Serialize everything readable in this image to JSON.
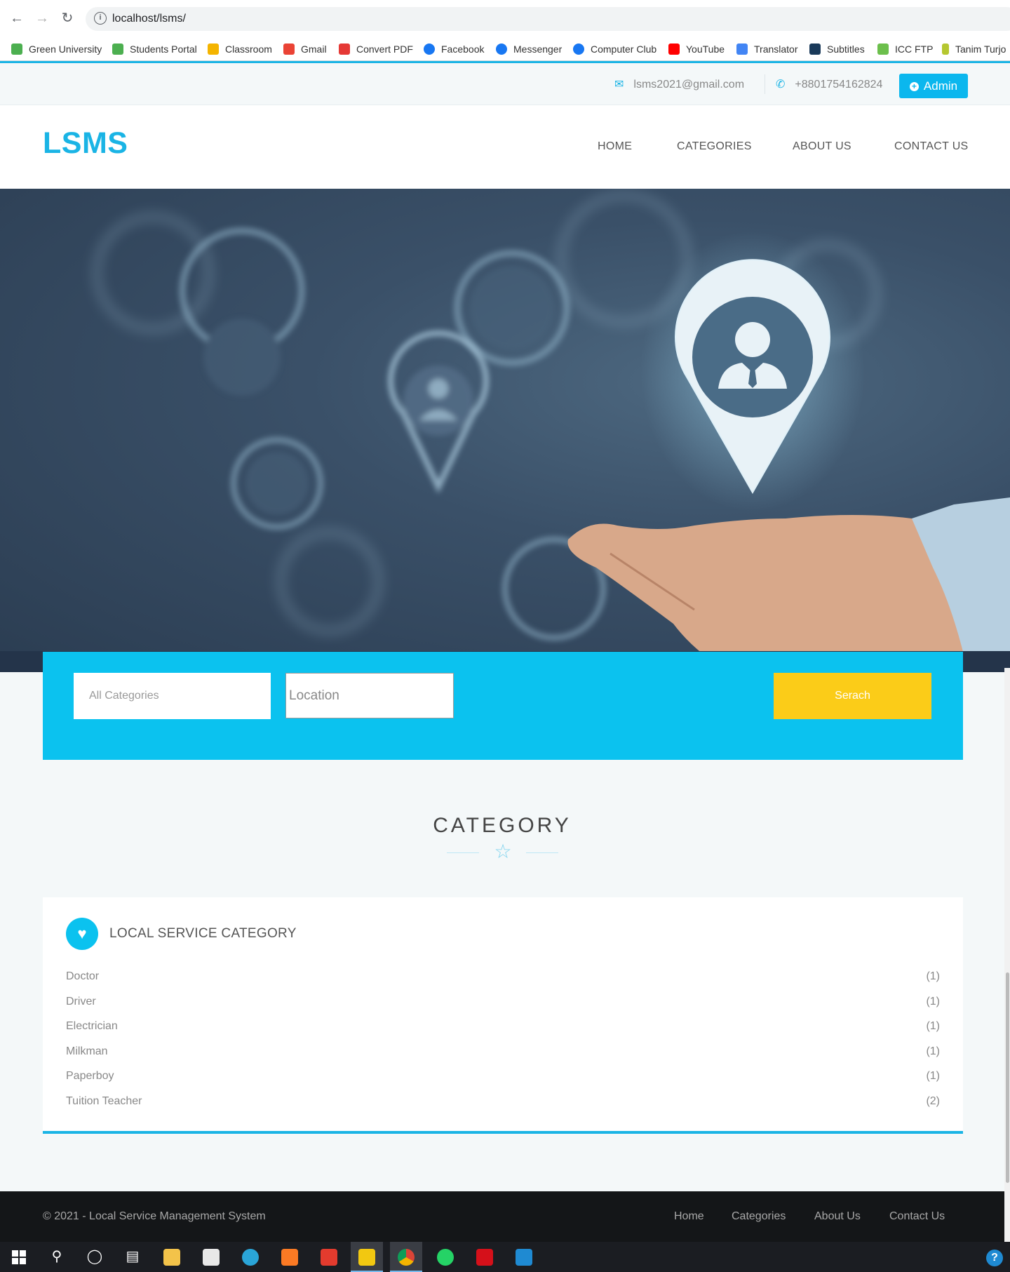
{
  "browser": {
    "url": "localhost/lsms/",
    "back_glyph": "←",
    "forward_glyph": "→",
    "reload_glyph": "↻",
    "info_glyph": "i"
  },
  "bookmarks": [
    {
      "label": "Green University",
      "icon": "green-university-icon",
      "color": "#4caf50"
    },
    {
      "label": "Students Portal",
      "icon": "students-portal-icon",
      "color": "#4caf50"
    },
    {
      "label": "Classroom",
      "icon": "classroom-icon",
      "color": "#f4b400"
    },
    {
      "label": "Gmail",
      "icon": "gmail-icon",
      "color": "#ea4335"
    },
    {
      "label": "Convert PDF",
      "icon": "convert-pdf-icon",
      "color": "#e53935"
    },
    {
      "label": "Facebook",
      "icon": "facebook-icon",
      "color": "#1877f2"
    },
    {
      "label": "Messenger",
      "icon": "messenger-icon",
      "color": "#1877f2"
    },
    {
      "label": "Computer Club",
      "icon": "computer-club-icon",
      "color": "#1877f2"
    },
    {
      "label": "YouTube",
      "icon": "youtube-icon",
      "color": "#ff0000"
    },
    {
      "label": "Translator",
      "icon": "translator-icon",
      "color": "#4285f4"
    },
    {
      "label": "Subtitles",
      "icon": "subtitles-icon",
      "color": "#1a3a5a"
    },
    {
      "label": "ICC FTP",
      "icon": "icc-ftp-icon",
      "color": "#6cbf4c"
    },
    {
      "label": "Tanim Turjo",
      "icon": "tanim-turjo-icon",
      "color": "#b5c730"
    }
  ],
  "topbar": {
    "email": "lsms2021@gmail.com",
    "phone": "+8801754162824",
    "admin_label": "Admin",
    "accent": "#1ab4e5"
  },
  "header": {
    "logo": "LSMS",
    "nav": [
      "HOME",
      "CATEGORIES",
      "ABOUT US",
      "CONTACT US"
    ]
  },
  "search": {
    "category_placeholder": "All Categories",
    "location_placeholder": "Location",
    "button_label": "Serach",
    "panel_color": "#0bc2ef",
    "button_color": "#fbcc18"
  },
  "category_section": {
    "title": "CATEGORY",
    "card_title": "LOCAL SERVICE CATEGORY",
    "items": [
      {
        "name": "Doctor",
        "count": "(1)"
      },
      {
        "name": "Driver",
        "count": "(1)"
      },
      {
        "name": "Electrician",
        "count": "(1)"
      },
      {
        "name": "Milkman",
        "count": "(1)"
      },
      {
        "name": "Paperboy",
        "count": "(1)"
      },
      {
        "name": "Tuition Teacher",
        "count": "(2)"
      }
    ]
  },
  "footer": {
    "copyright": "© 2021 - Local Service Management System",
    "links": [
      "Home",
      "Categories",
      "About Us",
      "Contact Us"
    ]
  },
  "taskbar": {
    "apps": [
      "windows-start-icon",
      "search-icon",
      "cortana-icon",
      "task-view-icon",
      "file-explorer-icon",
      "store-icon",
      "edge-icon",
      "xampp-icon",
      "office-app-icon",
      "power-bi-icon",
      "chrome-icon",
      "whatsapp-icon",
      "acrobat-icon",
      "vscode-icon"
    ],
    "help_glyph": "?"
  }
}
